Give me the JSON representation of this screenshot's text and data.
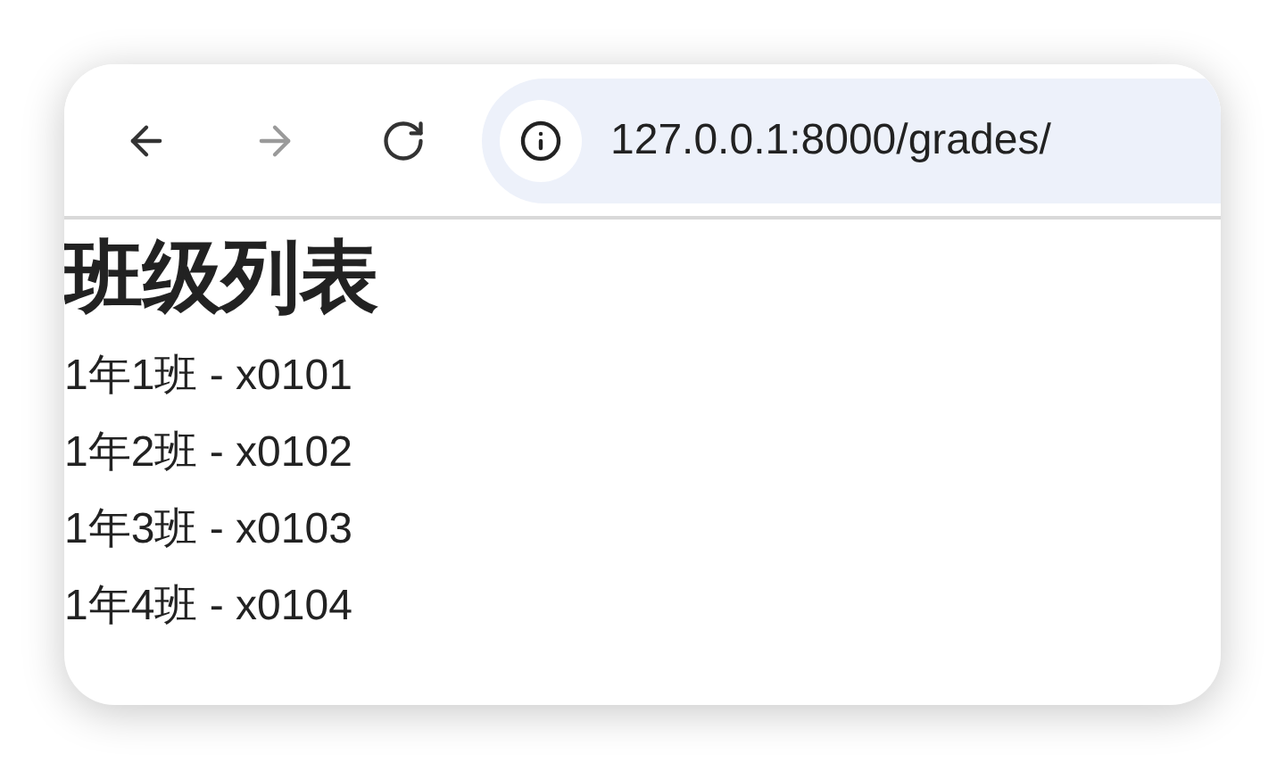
{
  "toolbar": {
    "nav_buttons": [
      {
        "kind": "back",
        "disabled": false
      },
      {
        "kind": "forward",
        "disabled": true
      },
      {
        "kind": "reload",
        "disabled": false
      }
    ],
    "address_bar": {
      "url": "127.0.0.1:8000/grades/"
    }
  },
  "page": {
    "heading": "班级列表",
    "items": [
      "1年1班 - x0101",
      "1年2班 - x0102",
      "1年3班 - x0103",
      "1年4班 - x0104"
    ]
  }
}
